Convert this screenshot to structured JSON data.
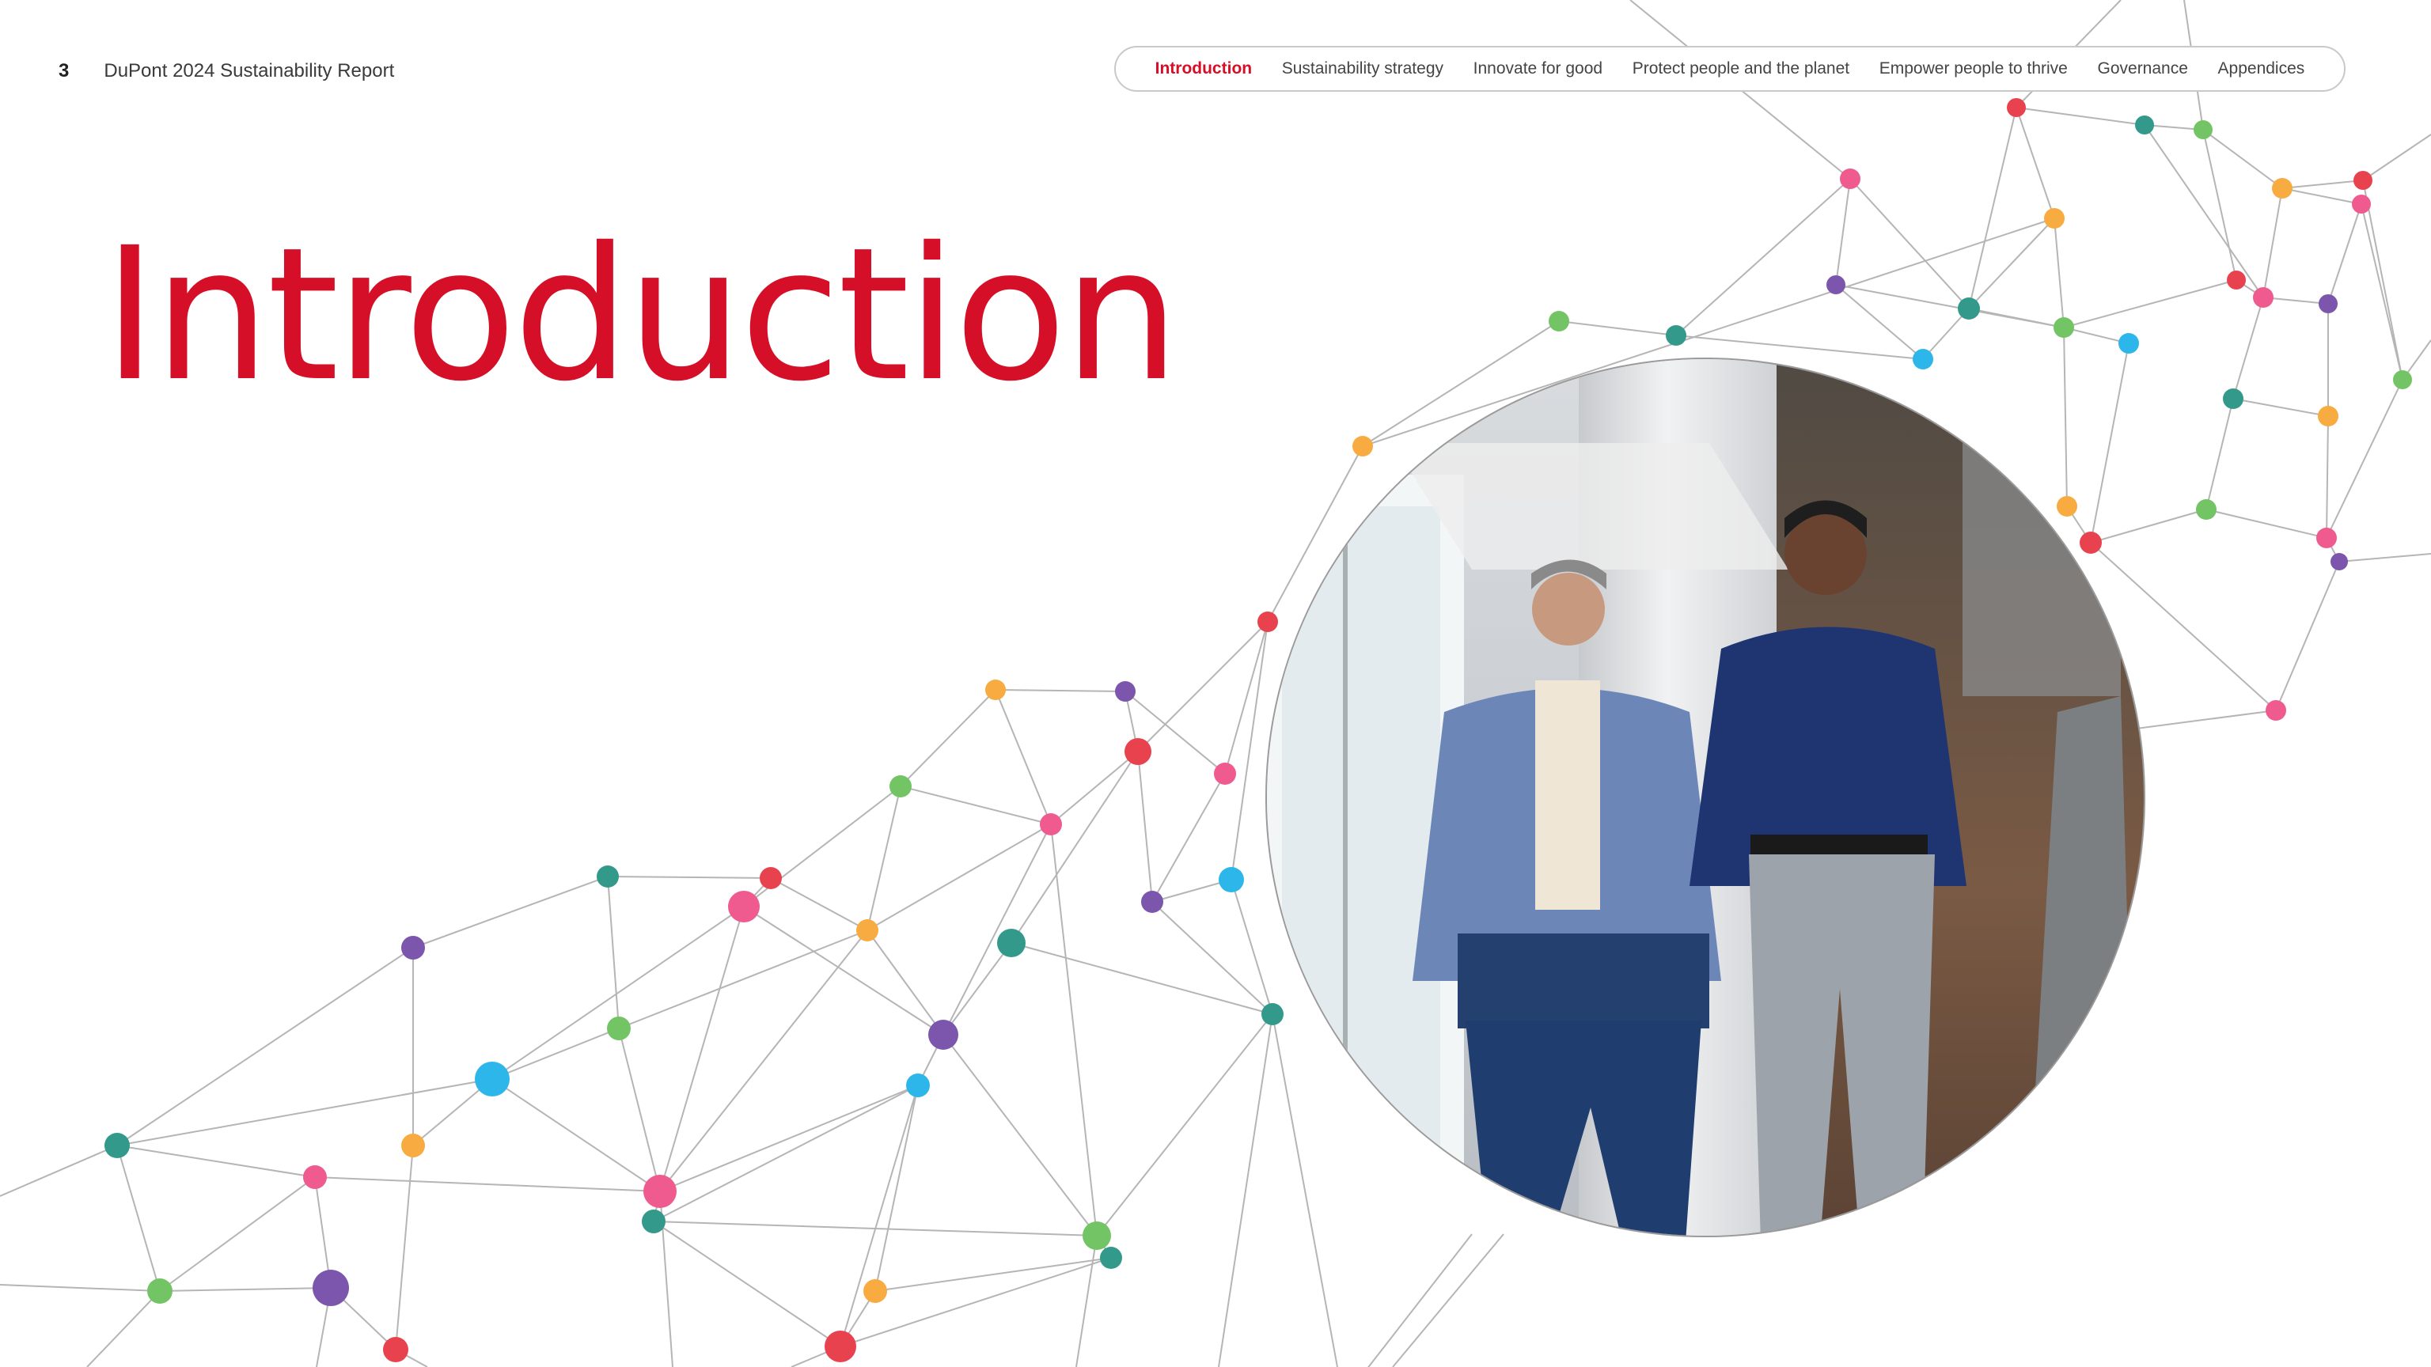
{
  "header": {
    "page_number": "3",
    "report_title": "DuPont 2024 Sustainability Report"
  },
  "nav": {
    "items": [
      {
        "label": "Introduction",
        "active": true
      },
      {
        "label": "Sustainability strategy",
        "active": false
      },
      {
        "label": "Innovate for good",
        "active": false
      },
      {
        "label": "Protect people and the planet",
        "active": false
      },
      {
        "label": "Empower people to thrive",
        "active": false
      },
      {
        "label": "Governance",
        "active": false
      },
      {
        "label": "Appendices",
        "active": false
      }
    ]
  },
  "main": {
    "title": "Introduction"
  },
  "colors": {
    "brand_red": "#d50f27",
    "node_red": "#e8424f",
    "node_pink": "#ef5b8e",
    "node_orange": "#f8ab40",
    "node_green": "#73c465",
    "node_teal": "#33998a",
    "node_purple": "#7c56ac",
    "node_blue": "#2db6ea",
    "line_gray": "#b5b5b5"
  },
  "image": {
    "subject": "photo-two-men-walking-in-office-hallway"
  }
}
